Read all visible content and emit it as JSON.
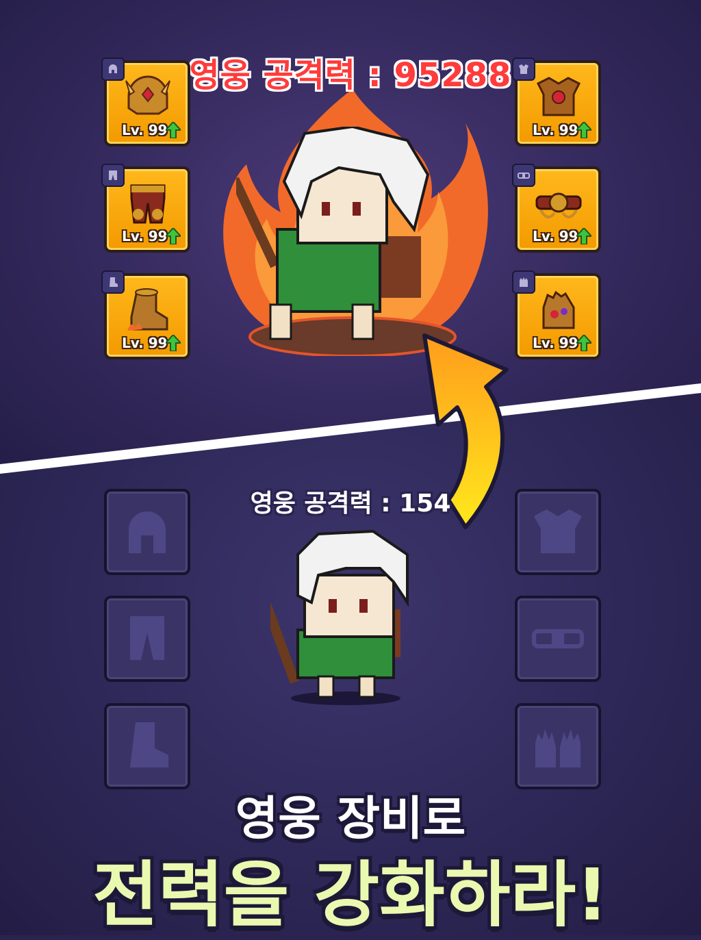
{
  "top_panel": {
    "attack_text": "영웅 공격력 : 95288",
    "slots": [
      {
        "slot": "helmet",
        "level": "Lv. 99",
        "tag_icon": "helmet-icon"
      },
      {
        "slot": "pants",
        "level": "Lv. 99",
        "tag_icon": "pants-icon"
      },
      {
        "slot": "boots",
        "level": "Lv. 99",
        "tag_icon": "boot-icon"
      },
      {
        "slot": "armor",
        "level": "Lv. 99",
        "tag_icon": "armor-icon"
      },
      {
        "slot": "belt",
        "level": "Lv. 99",
        "tag_icon": "belt-icon"
      },
      {
        "slot": "gloves",
        "level": "Lv. 99",
        "tag_icon": "gloves-icon"
      }
    ]
  },
  "bottom_panel": {
    "attack_text": "영웅 공격력 : 154"
  },
  "headline": {
    "line1": "영웅 장비로",
    "line2": "전력을 강화하라!"
  },
  "colors": {
    "slot_gold": "#ffb81c",
    "attack_red": "#ff3b3b",
    "headline_green": "#e9f9b0",
    "upgrade_arrow": "#3fc43f"
  }
}
